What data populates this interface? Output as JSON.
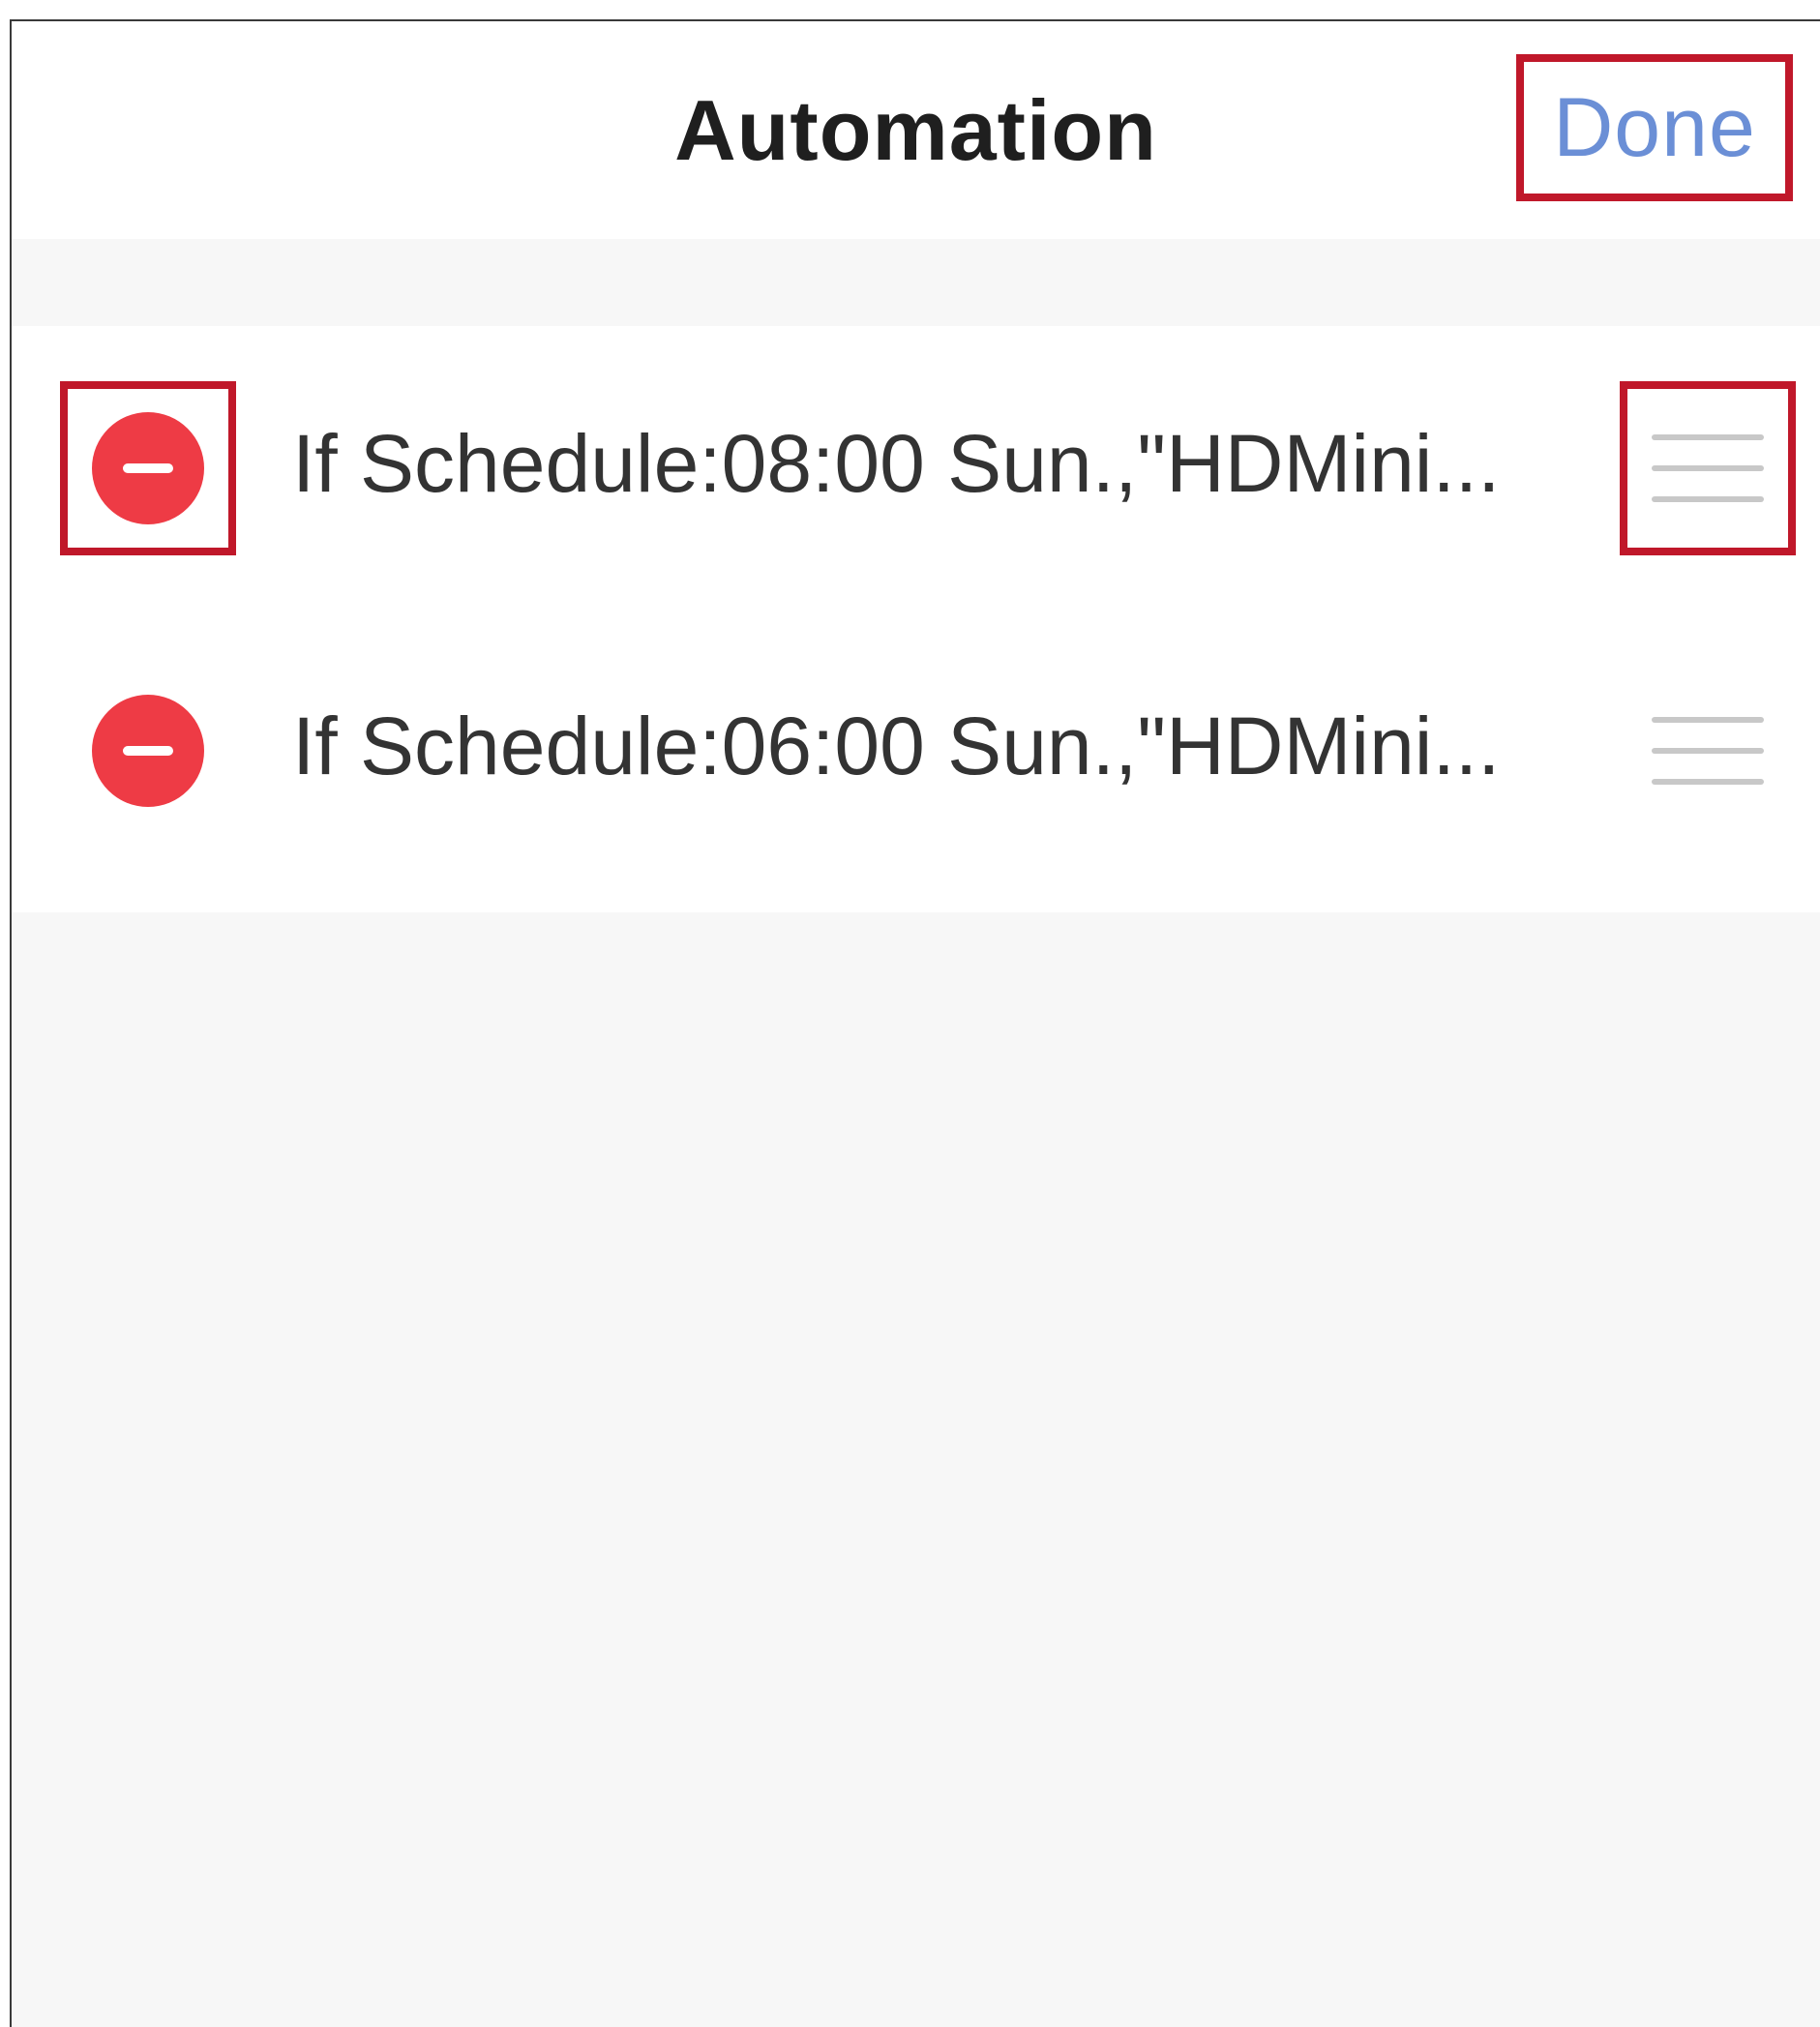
{
  "header": {
    "title": "Automation",
    "done_label": "Done"
  },
  "automations": [
    {
      "text": "If Schedule:08:00 Sun.,\"HDMini..."
    },
    {
      "text": "If Schedule:06:00 Sun.,\"HDMini..."
    }
  ],
  "colors": {
    "accent": "#6b8fd6",
    "delete": "#ee3b45",
    "highlight_box": "#c0182a",
    "background": "#f7f7f7"
  },
  "icons": {
    "remove": "minus-circle-icon",
    "reorder": "hamburger-icon"
  }
}
